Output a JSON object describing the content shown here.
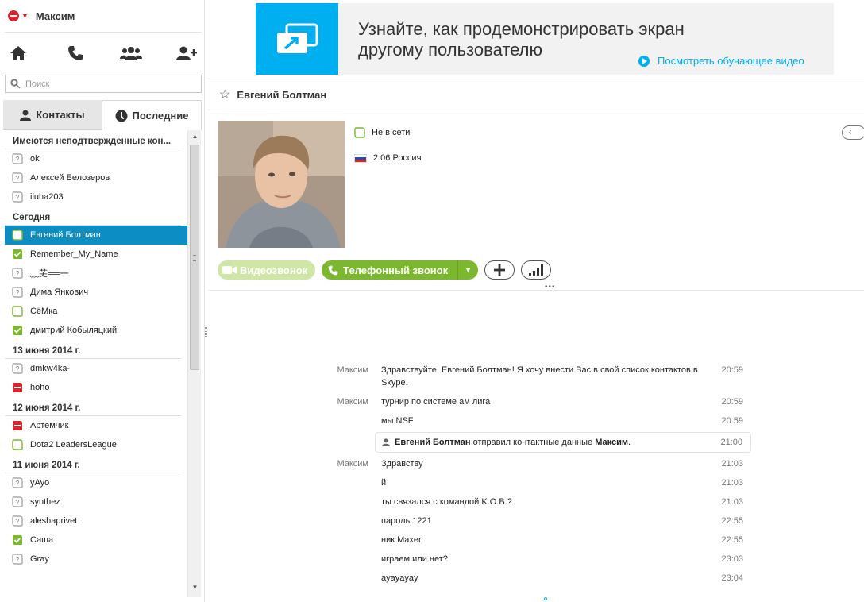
{
  "user": {
    "name": "Максим"
  },
  "search": {
    "placeholder": "Поиск"
  },
  "tabs": {
    "contacts": "Контакты",
    "recent": "Последние"
  },
  "groups": [
    {
      "title": "Имеются неподтвержденные кон...",
      "contacts": [
        {
          "name": "ok",
          "status": "unknown"
        },
        {
          "name": "Алексей Белозеров",
          "status": "unknown"
        },
        {
          "name": "iluha203",
          "status": "unknown"
        }
      ]
    },
    {
      "title": "Сегодня",
      "contacts": [
        {
          "name": "Евгений Болтман",
          "status": "offline",
          "selected": true
        },
        {
          "name": "Remember_My_Name",
          "status": "online"
        },
        {
          "name": "﹏芜══一",
          "status": "unknown"
        },
        {
          "name": "Дима Янкович",
          "status": "unknown"
        },
        {
          "name": "СёМка",
          "status": "offline"
        },
        {
          "name": "дмитрий Кобыляцкий",
          "status": "online"
        }
      ]
    },
    {
      "title": "13 июня 2014 г.",
      "contacts": [
        {
          "name": "dmkw4ka-",
          "status": "unknown"
        },
        {
          "name": "hoho",
          "status": "busy"
        }
      ]
    },
    {
      "title": "12 июня 2014 г.",
      "contacts": [
        {
          "name": "Артемчик",
          "status": "busy"
        },
        {
          "name": "Dota2 LeadersLeague",
          "status": "offline"
        }
      ]
    },
    {
      "title": "11 июня 2014 г.",
      "contacts": [
        {
          "name": "yAyo",
          "status": "unknown"
        },
        {
          "name": "synthez",
          "status": "unknown"
        },
        {
          "name": "aleshaprivet",
          "status": "unknown"
        },
        {
          "name": "Саша",
          "status": "online"
        },
        {
          "name": "Gray",
          "status": "unknown"
        }
      ]
    }
  ],
  "banner": {
    "title": "Узнайте, как продемонстрировать экран другому пользователю",
    "link": "Посмотреть обучающее видео"
  },
  "conversation": {
    "title": "Евгений Болтман",
    "presence": "Не в сети",
    "location": "2:06 Россия",
    "video_label": "Видеозвонок",
    "call_label": "Телефонный звонок"
  },
  "messages": [
    {
      "sender": "Максим",
      "text": "Здравствуйте, Евгений Болтман! Я хочу внести Вас в свой список контактов в Skype.",
      "time": "20:59"
    },
    {
      "sender": "Максим",
      "text": "турнир по системе ам лига",
      "time": "20:59"
    },
    {
      "sender": "",
      "text": "мы NSF",
      "time": "20:59"
    },
    {
      "notice": true,
      "from": "Евгений Болтман",
      "middle": " отправил контактные данные ",
      "to": "Максим",
      "end": ".",
      "time": "21:00"
    },
    {
      "sender": "Максим",
      "text": "Здравству",
      "time": "21:03"
    },
    {
      "sender": "",
      "text": "й",
      "time": "21:03"
    },
    {
      "sender": "",
      "text": "ты связался с командой K.O.B.?",
      "time": "21:03"
    },
    {
      "sender": "",
      "text": "пароль 1221",
      "time": "22:55"
    },
    {
      "sender": "",
      "text": "ник Maxer",
      "time": "22:55"
    },
    {
      "sender": "",
      "text": "играем или нет?",
      "time": "23:03"
    },
    {
      "sender": "",
      "text": "ayayayay",
      "time": "23:04"
    }
  ],
  "colors": {
    "accent": "#00aff0",
    "selected": "#0c8dc4",
    "online": "#7cb82f",
    "busy": "#d9262e"
  },
  "icons": [
    "home-icon",
    "phone-icon",
    "group-icon",
    "add-contact-icon",
    "search-icon",
    "person-icon",
    "clock-icon",
    "star-icon",
    "screen-share-icon",
    "play-icon",
    "video-icon",
    "plus-icon",
    "signal-icon"
  ]
}
